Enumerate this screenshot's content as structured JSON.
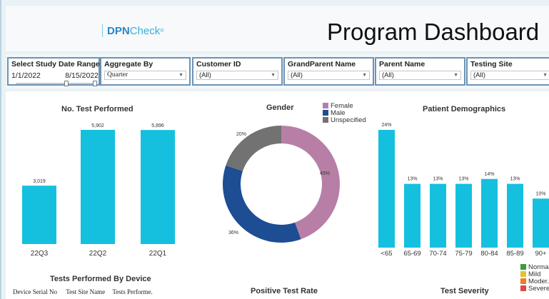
{
  "header": {
    "logo_prefix": "DPN",
    "logo_suffix": "Check",
    "logo_mark": "®",
    "title": "Program Dashboard"
  },
  "filters": {
    "date_range": {
      "label": "Select Study Date Range",
      "start": "1/1/2022",
      "end": "8/15/2022"
    },
    "aggregate": {
      "label": "Aggregate By",
      "value": "Quarter"
    },
    "customer": {
      "label": "Customer ID",
      "value": "(All)"
    },
    "grandparent": {
      "label": "GrandParent Name",
      "value": "(All)"
    },
    "parent": {
      "label": "Parent Name",
      "value": "(All)"
    },
    "site": {
      "label": "Testing Site",
      "value": "(All)"
    }
  },
  "colors": {
    "bar": "#15c0de",
    "female": "#b87fa6",
    "male": "#1d4d93",
    "unspecified": "#727272",
    "normal": "#3a9c3a",
    "mild": "#e3c232",
    "moderate": "#ee7e22",
    "severe": "#e04848"
  },
  "sections": {
    "tests_by_device": "Tests Performed By Device",
    "positive_rate": "Positive Test Rate",
    "severity": "Test Severity"
  },
  "device_table": {
    "headers": [
      "Device Serial No",
      "Test Site Name",
      "Tests Performe."
    ]
  },
  "chart_data": [
    {
      "type": "bar",
      "title": "No. Test Performed",
      "categories": [
        "22Q3",
        "22Q2",
        "22Q1"
      ],
      "values": [
        3019,
        5902,
        5896
      ],
      "labels": [
        "3,019",
        "5,902",
        "5,896"
      ]
    },
    {
      "type": "pie",
      "title": "Gender",
      "categories": [
        "Female",
        "Male",
        "Unspecified"
      ],
      "values": [
        45,
        36,
        20
      ],
      "labels": [
        "45%",
        "36%",
        "20%"
      ],
      "legend": "top-right"
    },
    {
      "type": "bar",
      "title": "Patient Demographics",
      "categories": [
        "<65",
        "65-69",
        "70-74",
        "75-79",
        "80-84",
        "85-89",
        "90+"
      ],
      "values": [
        24,
        13,
        13,
        13,
        14,
        13,
        10
      ],
      "labels": [
        "24%",
        "13%",
        "13%",
        "13%",
        "14%",
        "13%",
        "10%"
      ]
    },
    {
      "type": "bar",
      "title": "Test Severity",
      "categories": [
        "Normal",
        "Mild",
        "Moder..",
        "Severe"
      ],
      "values": [],
      "legend": "right"
    }
  ]
}
